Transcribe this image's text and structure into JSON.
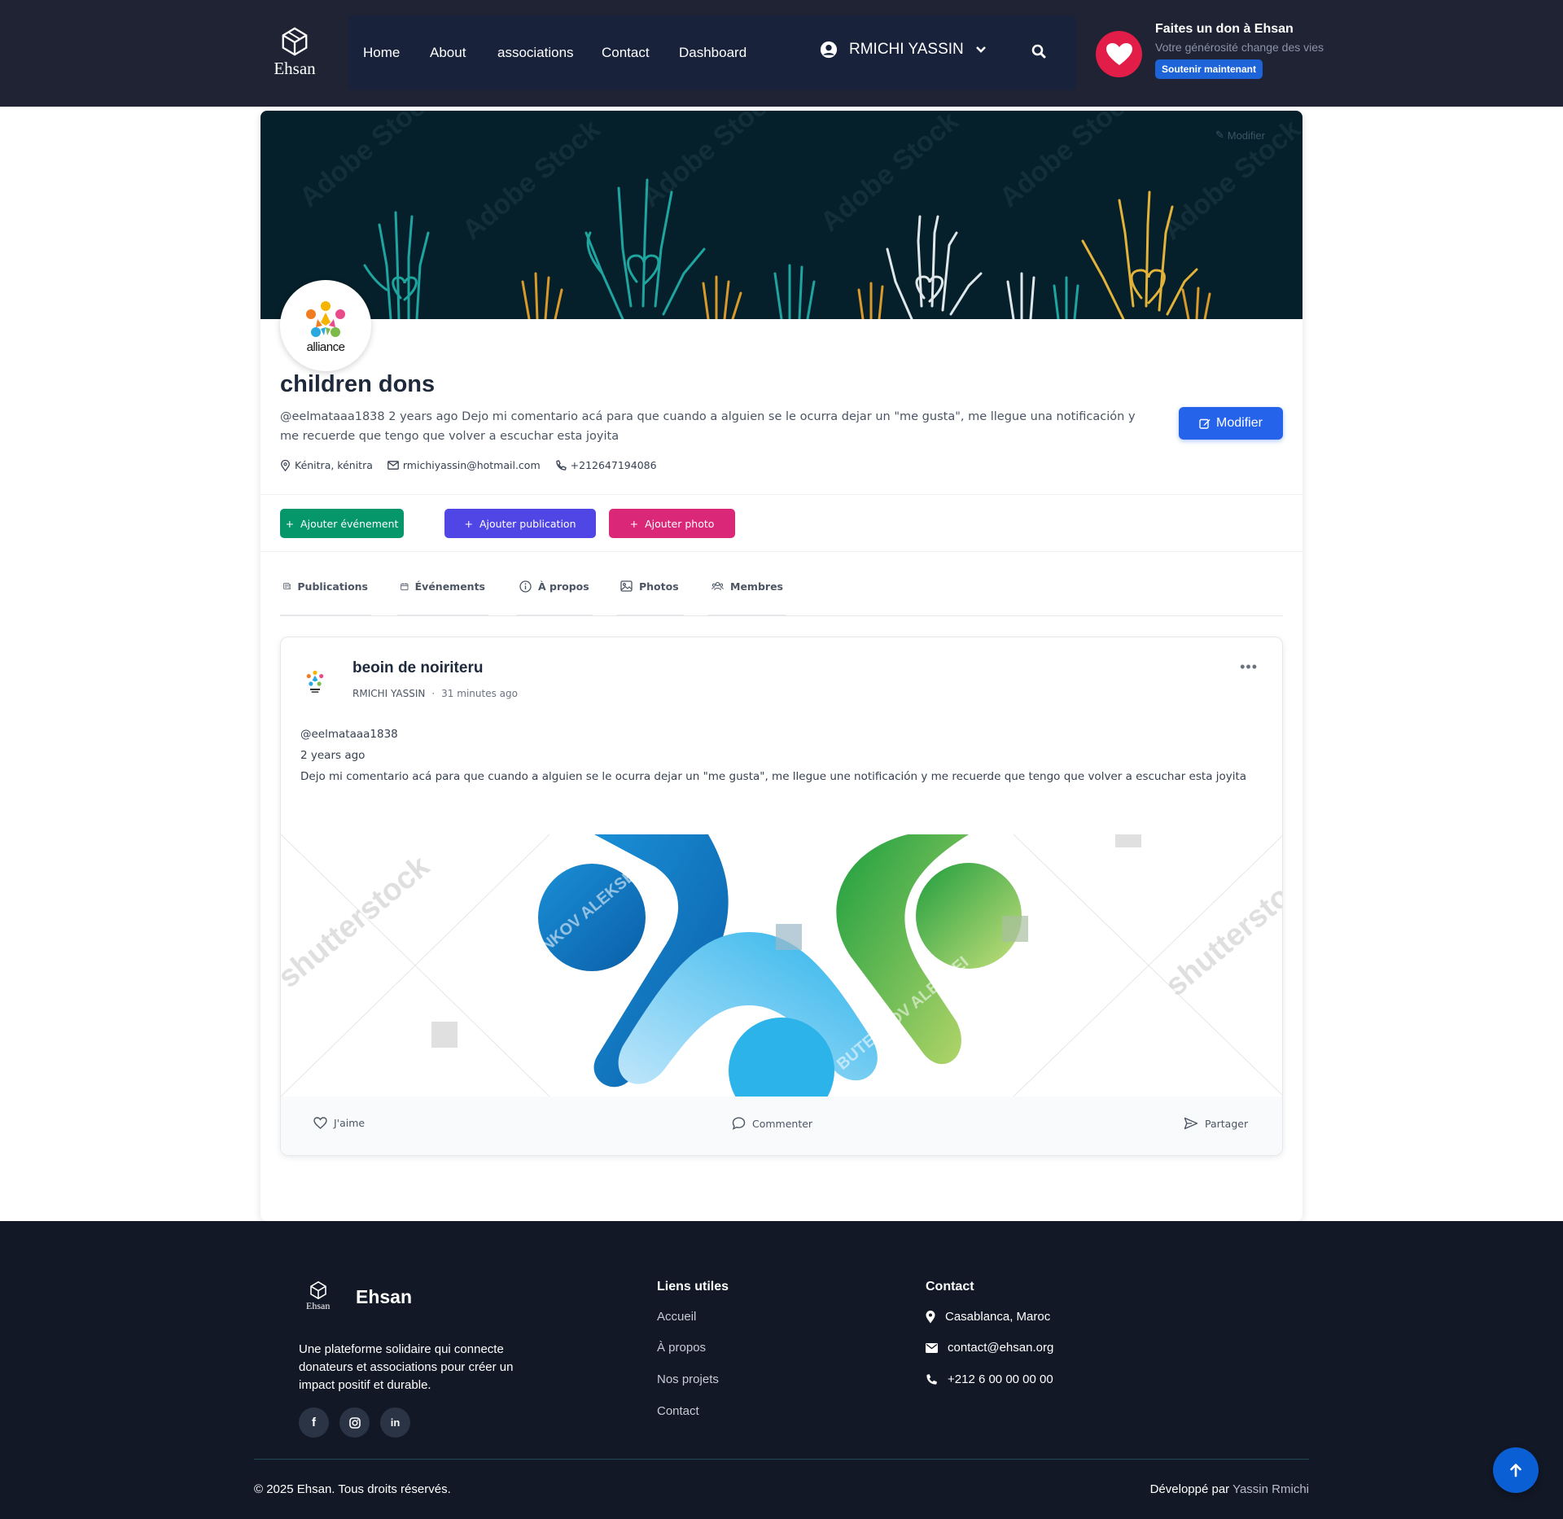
{
  "header": {
    "logo_text": "Ehsan",
    "nav": [
      "Home",
      "About",
      "associations",
      "Contact",
      "Dashboard"
    ],
    "user_name": "RMICHI YASSIN",
    "donate": {
      "title": "Faites un don à Ehsan",
      "subtitle": "Votre générosité change des vies",
      "button": "Soutenir maintenant"
    }
  },
  "profile": {
    "cover_edit_label": "Modifier",
    "cover_watermark": "Adobe Stock",
    "avatar_text": "alliance",
    "name": "children dons",
    "description": "@eelmataaa1838 2 years ago Dejo mi comentario acá para que cuando a alguien se le ocurra dejar un \"me gusta\", me llegue una notificación y me recuerde que tengo que volver a escuchar esta joyita",
    "location": "Kénitra, kénitra",
    "email": "rmichiyassin@hotmail.com",
    "phone": "+212647194086",
    "edit_button": "Modifier"
  },
  "actions": [
    "Ajouter événement",
    "Ajouter publication",
    "Ajouter photo"
  ],
  "tabs": [
    "Publications",
    "Événements",
    "À propos",
    "Photos",
    "Membres"
  ],
  "post": {
    "title": "beoin de noiriteru",
    "author": "RMICHI YASSIN",
    "time": "31 minutes ago",
    "body_lines": [
      "@eelmataaa1838",
      "2 years ago",
      "Dejo mi comentario acá para que cuando a alguien se le ocurra dejar un \"me gusta\", me llegue une notificación y me recuerde que tengo que volver a escuchar esta joyita"
    ],
    "image_watermarks": [
      "shutterstock",
      "BUTENKOV ALEKSEI"
    ],
    "like": "J'aime",
    "comment": "Commenter",
    "share": "Partager"
  },
  "footer": {
    "logo_small": "Ehsan",
    "brand": "Ehsan",
    "description": "Une plateforme solidaire qui connecte donateurs et associations pour créer un impact positif et durable.",
    "links_title": "Liens utiles",
    "links": [
      "Accueil",
      "À propos",
      "Nos projets",
      "Contact"
    ],
    "contact_title": "Contact",
    "address": "Casablanca, Maroc",
    "email": "contact@ehsan.org",
    "phone": "+212 6 00 00 00 00",
    "copyright": "© 2025 Ehsan. Tous droits réservés.",
    "dev_prefix": "Développé par",
    "dev_name": "Yassin Rmichi"
  },
  "colors": {
    "header_bg": "#1f2333",
    "nav_bg": "#18223a",
    "primary": "#2563eb",
    "green": "#059669",
    "indigo": "#4f46e5",
    "pink": "#db2777",
    "heart": "#e11d48",
    "footer_bg": "#121826"
  }
}
